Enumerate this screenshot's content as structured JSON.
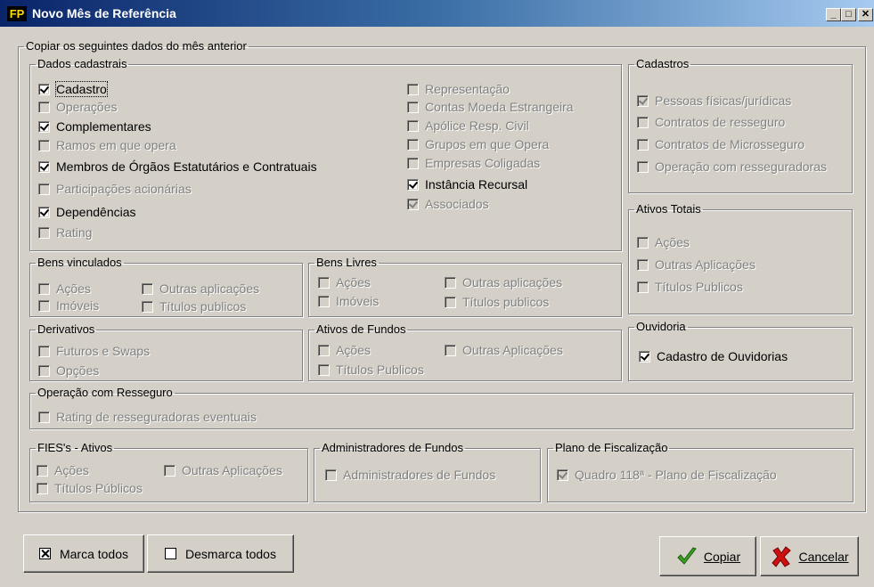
{
  "window": {
    "app_icon": "FP",
    "title": "Novo Mês de Referência",
    "minimize": "_",
    "maximize": "□",
    "close": "✕"
  },
  "outer": {
    "legend": "Copiar os seguintes dados do mês anterior"
  },
  "dados_cadastrais": {
    "legend": "Dados cadastrais",
    "items": [
      {
        "label": "Cadastro",
        "checked": true,
        "enabled": true
      },
      {
        "label": "Operações",
        "checked": false,
        "enabled": false
      },
      {
        "label": "Complementares",
        "checked": true,
        "enabled": true
      },
      {
        "label": "Ramos em que opera",
        "checked": false,
        "enabled": false
      },
      {
        "label": "Membros de Órgãos Estatutários e Contratuais",
        "checked": true,
        "enabled": true
      },
      {
        "label": "Participações acionárias",
        "checked": false,
        "enabled": false
      },
      {
        "label": "Dependências",
        "checked": true,
        "enabled": true
      },
      {
        "label": "Rating",
        "checked": false,
        "enabled": false
      },
      {
        "label": "Representação",
        "checked": false,
        "enabled": false
      },
      {
        "label": "Contas Moeda Estrangeira",
        "checked": false,
        "enabled": false
      },
      {
        "label": "Apólice Resp. Civil",
        "checked": false,
        "enabled": false
      },
      {
        "label": "Grupos em que Opera",
        "checked": false,
        "enabled": false
      },
      {
        "label": "Empresas Coligadas",
        "checked": false,
        "enabled": false
      },
      {
        "label": "Instância Recursal",
        "checked": true,
        "enabled": true
      },
      {
        "label": "Associados",
        "checked": true,
        "enabled": false
      }
    ]
  },
  "cadastros": {
    "legend": "Cadastros",
    "items": [
      {
        "label": "Pessoas físicas/jurídicas",
        "checked": true,
        "enabled": false
      },
      {
        "label": "Contratos de resseguro",
        "checked": false,
        "enabled": false
      },
      {
        "label": "Contratos de Microsseguro",
        "checked": false,
        "enabled": false
      },
      {
        "label": "Operação com resseguradoras",
        "checked": false,
        "enabled": false
      }
    ]
  },
  "ativos_totais": {
    "legend": "Ativos Totais",
    "items": [
      {
        "label": "Ações",
        "checked": false,
        "enabled": false
      },
      {
        "label": "Outras Aplicações",
        "checked": false,
        "enabled": false
      },
      {
        "label": "Títulos Publicos",
        "checked": false,
        "enabled": false
      }
    ]
  },
  "bens_vinculados": {
    "legend": "Bens vinculados",
    "items": [
      {
        "label": "Ações",
        "checked": false,
        "enabled": false
      },
      {
        "label": "Imóveis",
        "checked": false,
        "enabled": false
      },
      {
        "label": "Outras aplicações",
        "checked": false,
        "enabled": false
      },
      {
        "label": "Títulos publicos",
        "checked": false,
        "enabled": false
      }
    ]
  },
  "bens_livres": {
    "legend": "Bens Livres",
    "items": [
      {
        "label": "Ações",
        "checked": false,
        "enabled": false
      },
      {
        "label": "Imóveis",
        "checked": false,
        "enabled": false
      },
      {
        "label": "Outras aplicações",
        "checked": false,
        "enabled": false
      },
      {
        "label": "Títulos publicos",
        "checked": false,
        "enabled": false
      }
    ]
  },
  "derivativos": {
    "legend": "Derivativos",
    "items": [
      {
        "label": "Futuros e Swaps",
        "checked": false,
        "enabled": false
      },
      {
        "label": "Opções",
        "checked": false,
        "enabled": false
      }
    ]
  },
  "ativos_fundos": {
    "legend": "Ativos de Fundos",
    "items": [
      {
        "label": "Ações",
        "checked": false,
        "enabled": false
      },
      {
        "label": "Títulos Publicos",
        "checked": false,
        "enabled": false
      },
      {
        "label": "Outras Aplicações",
        "checked": false,
        "enabled": false
      }
    ]
  },
  "ouvidoria": {
    "legend": "Ouvidoria",
    "items": [
      {
        "label": "Cadastro de Ouvidorias",
        "checked": true,
        "enabled": true
      }
    ]
  },
  "operacao_resseguro": {
    "legend": "Operação com Resseguro",
    "items": [
      {
        "label": "Rating de resseguradoras eventuais",
        "checked": false,
        "enabled": false
      }
    ]
  },
  "fies": {
    "legend": "FIES's - Ativos",
    "items": [
      {
        "label": "Ações",
        "checked": false,
        "enabled": false
      },
      {
        "label": "Títulos Públicos",
        "checked": false,
        "enabled": false
      },
      {
        "label": "Outras Aplicações",
        "checked": false,
        "enabled": false
      }
    ]
  },
  "admin_fundos": {
    "legend": "Administradores de Fundos",
    "items": [
      {
        "label": "Administradores de Fundos",
        "checked": false,
        "enabled": false
      }
    ]
  },
  "plano_fiscalizacao": {
    "legend": "Plano de Fiscalização",
    "items": [
      {
        "label": "Quadro 118ª  - Plano de Fiscalização",
        "checked": true,
        "enabled": false
      }
    ]
  },
  "buttons": {
    "marca_todos": "Marca todos",
    "desmarca_todos": "Desmarca todos",
    "copiar": "Copiar",
    "cancelar": "Cancelar"
  }
}
